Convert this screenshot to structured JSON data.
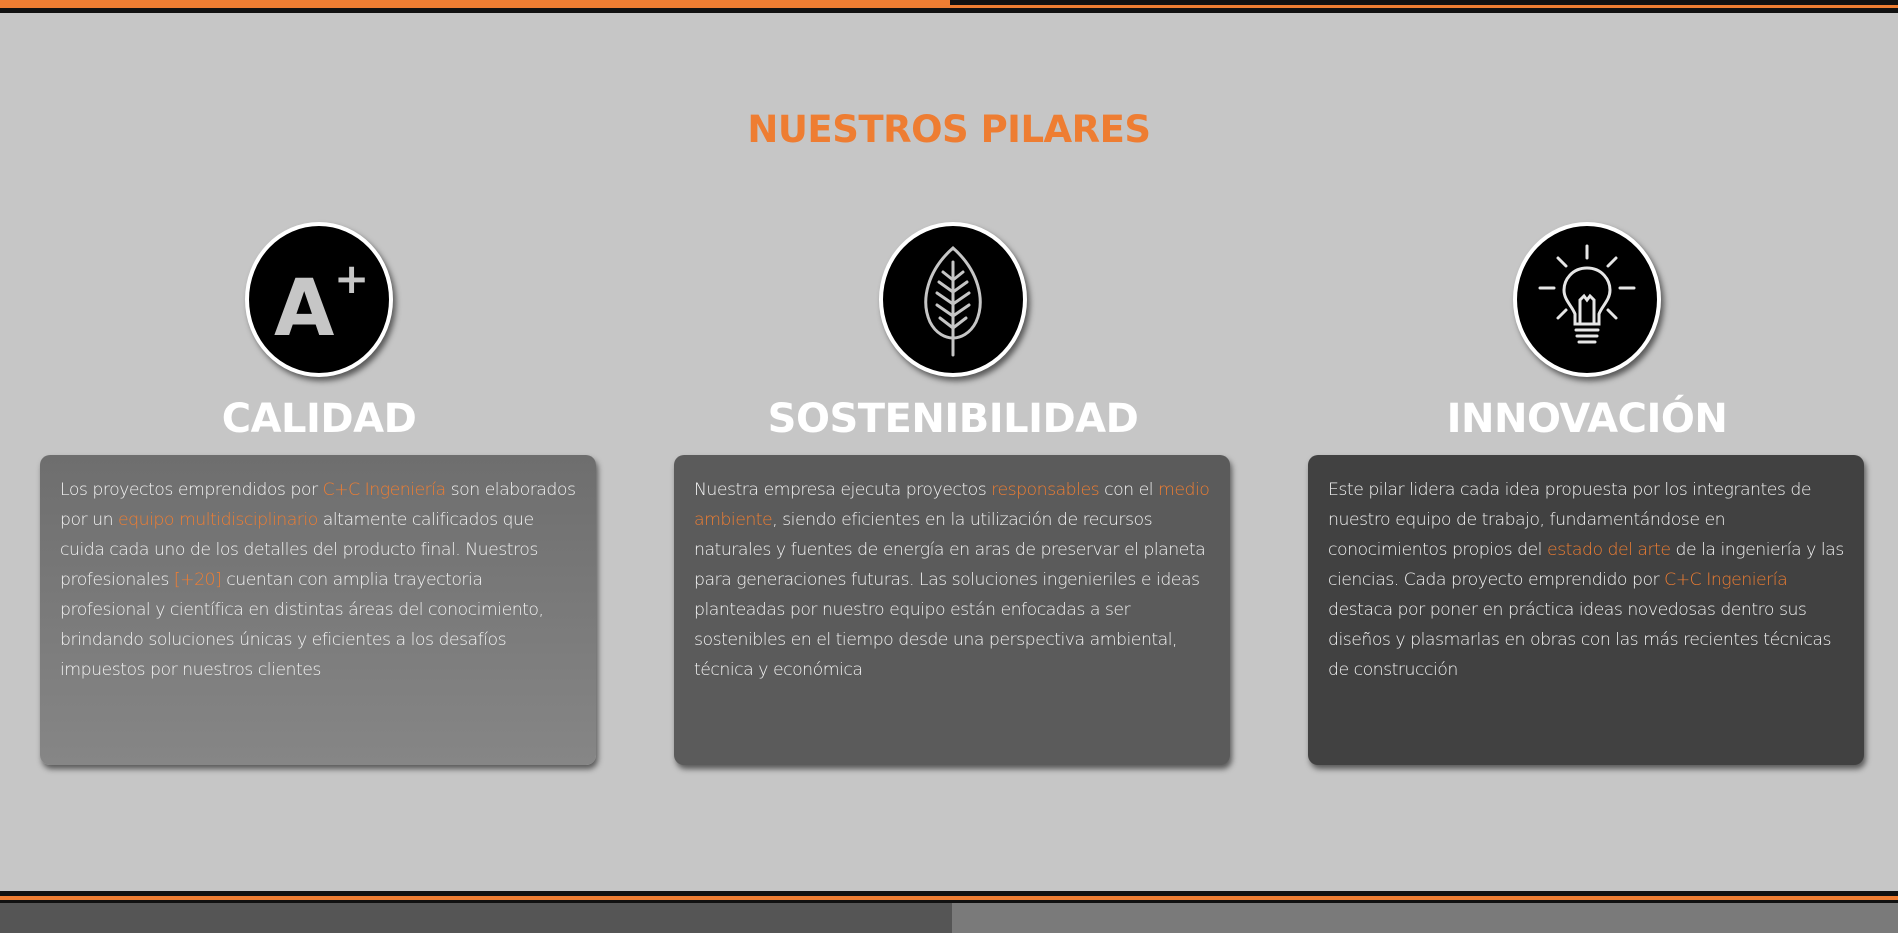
{
  "section": {
    "title": "NUESTROS PILARES"
  },
  "colors": {
    "accent": "#ee7d32",
    "background": "#c6c6c6",
    "text": "#ffffff"
  },
  "pillars": [
    {
      "icon": "a-plus-icon",
      "title": "CALIDAD",
      "text": {
        "s1": "Los proyectos emprendidos por ",
        "h1": "C+C Ingeniería",
        "s2": " son elaborados por un ",
        "h2": "equipo multidisciplinario",
        "s3": " altamente calificados que cuida cada uno de los detalles del producto final. Nuestros profesionales ",
        "h3": "[+20]",
        "s4": " cuentan con amplia trayectoria profesional y científica en distintas áreas del conocimiento, brindando soluciones únicas y eficientes a los desafíos impuestos por nuestros clientes"
      }
    },
    {
      "icon": "leaf-icon",
      "title": "SOSTENIBILIDAD",
      "text": {
        "s1": "Nuestra empresa ejecuta proyectos ",
        "h1": "responsables",
        "s2": " con el ",
        "h2": "medio ambiente",
        "s3": ", siendo eficientes en la utilización de recursos naturales y fuentes de energía en aras de preservar el planeta para generaciones futuras. Las soluciones ingenieriles e ideas planteadas por nuestro equipo están enfocadas a ser sostenibles en el tiempo desde una perspectiva ambiental, técnica y económica"
      }
    },
    {
      "icon": "lightbulb-icon",
      "title": "INNOVACIÓN",
      "text": {
        "s1": "Este pilar lidera cada idea propuesta por los integrantes de nuestro equipo de trabajo, fundamentándose en conocimientos propios del ",
        "h1": "estado del arte",
        "s2": " de la ingeniería y las ciencias. Cada proyecto emprendido por ",
        "h2": "C+C Ingeniería",
        "s3": " destaca por poner en práctica ideas novedosas dentro sus diseños y plasmarlas en obras con las más recientes técnicas de construcción"
      }
    }
  ]
}
